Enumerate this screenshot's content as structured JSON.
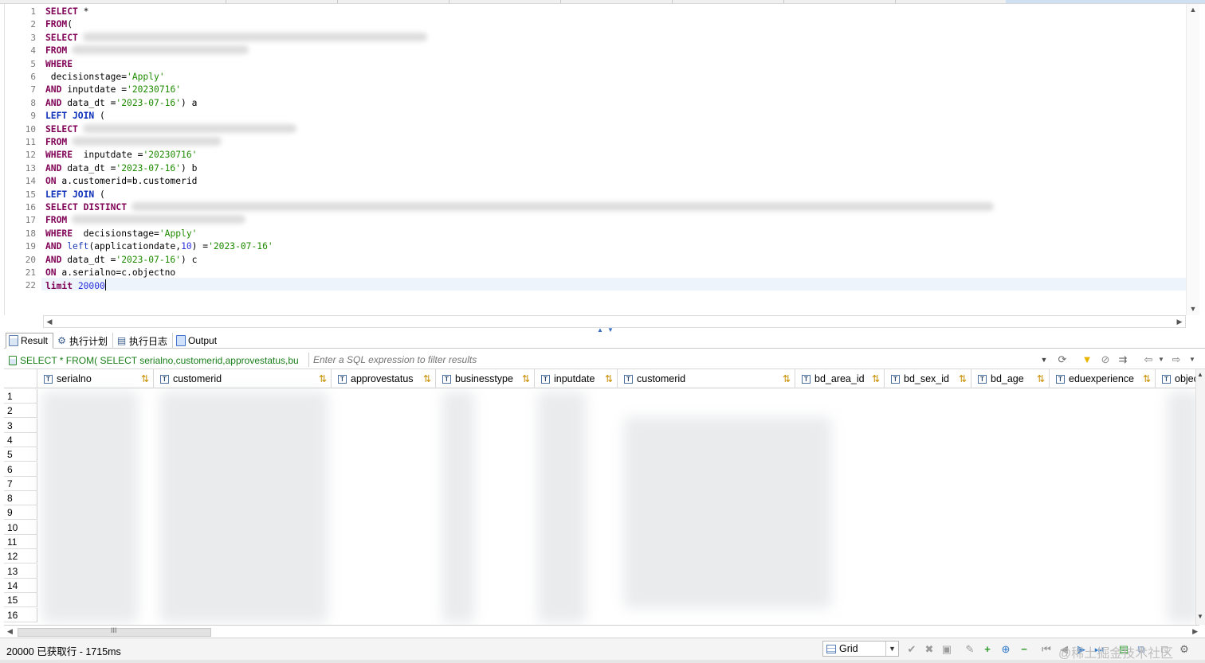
{
  "editor": {
    "lines": [
      {
        "n": "1",
        "tokens": [
          {
            "t": "SELECT",
            "c": "kw"
          },
          {
            "t": " *",
            "c": ""
          }
        ]
      },
      {
        "n": "2",
        "tokens": [
          {
            "t": "FROM",
            "c": "kw"
          },
          {
            "t": "(",
            "c": ""
          }
        ]
      },
      {
        "n": "3",
        "tokens": [
          {
            "t": "SELECT",
            "c": "kw"
          }
        ],
        "blur": 432
      },
      {
        "n": "4",
        "tokens": [
          {
            "t": "FROM",
            "c": "kw"
          }
        ],
        "blur": 222
      },
      {
        "n": "5",
        "tokens": [
          {
            "t": "WHERE",
            "c": "kw"
          }
        ]
      },
      {
        "n": "6",
        "tokens": [
          {
            "t": " decisionstage=",
            "c": ""
          },
          {
            "t": "'Apply'",
            "c": "str"
          }
        ]
      },
      {
        "n": "7",
        "tokens": [
          {
            "t": "AND",
            "c": "kw"
          },
          {
            "t": " inputdate =",
            "c": ""
          },
          {
            "t": "'20230716'",
            "c": "str"
          }
        ]
      },
      {
        "n": "8",
        "tokens": [
          {
            "t": "AND",
            "c": "kw"
          },
          {
            "t": " data_dt =",
            "c": ""
          },
          {
            "t": "'2023-07-16'",
            "c": "str"
          },
          {
            "t": ") a",
            "c": ""
          }
        ]
      },
      {
        "n": "9",
        "tokens": [
          {
            "t": "LEFT JOIN",
            "c": "kw2"
          },
          {
            "t": " (",
            "c": ""
          }
        ]
      },
      {
        "n": "10",
        "tokens": [
          {
            "t": "SELECT",
            "c": "kw"
          }
        ],
        "blur": 268
      },
      {
        "n": "11",
        "tokens": [
          {
            "t": "FROM",
            "c": "kw"
          }
        ],
        "blur": 188
      },
      {
        "n": "12",
        "tokens": [
          {
            "t": "WHERE",
            "c": "kw"
          },
          {
            "t": "  inputdate =",
            "c": ""
          },
          {
            "t": "'20230716'",
            "c": "str"
          }
        ]
      },
      {
        "n": "13",
        "tokens": [
          {
            "t": "AND",
            "c": "kw"
          },
          {
            "t": " data_dt =",
            "c": ""
          },
          {
            "t": "'2023-07-16'",
            "c": "str"
          },
          {
            "t": ") b",
            "c": ""
          }
        ]
      },
      {
        "n": "14",
        "tokens": [
          {
            "t": "ON",
            "c": "kw"
          },
          {
            "t": " a.customerid=b.customerid",
            "c": ""
          }
        ]
      },
      {
        "n": "15",
        "tokens": [
          {
            "t": "LEFT JOIN",
            "c": "kw2"
          },
          {
            "t": " (",
            "c": ""
          }
        ]
      },
      {
        "n": "16",
        "tokens": [
          {
            "t": "SELECT DISTINCT",
            "c": "kw"
          }
        ],
        "blur": 1082
      },
      {
        "n": "17",
        "tokens": [
          {
            "t": "FROM",
            "c": "kw"
          }
        ],
        "blur": 218
      },
      {
        "n": "18",
        "tokens": [
          {
            "t": "WHERE",
            "c": "kw"
          },
          {
            "t": "  decisionstage=",
            "c": ""
          },
          {
            "t": "'Apply'",
            "c": "str"
          }
        ]
      },
      {
        "n": "19",
        "tokens": [
          {
            "t": "AND",
            "c": "kw"
          },
          {
            "t": " ",
            "c": ""
          },
          {
            "t": "left",
            "c": "fn"
          },
          {
            "t": "(applicationdate,",
            "c": ""
          },
          {
            "t": "10",
            "c": "num"
          },
          {
            "t": ") =",
            "c": ""
          },
          {
            "t": "'2023-07-16'",
            "c": "str"
          }
        ]
      },
      {
        "n": "20",
        "tokens": [
          {
            "t": "AND",
            "c": "kw"
          },
          {
            "t": " data_dt =",
            "c": ""
          },
          {
            "t": "'2023-07-16'",
            "c": "str"
          },
          {
            "t": ") c",
            "c": ""
          }
        ]
      },
      {
        "n": "21",
        "tokens": [
          {
            "t": "ON",
            "c": "kw"
          },
          {
            "t": " a.serialno=c.objectno",
            "c": ""
          }
        ]
      },
      {
        "n": "22",
        "tokens": [
          {
            "t": "limit",
            "c": "kw"
          },
          {
            "t": " ",
            "c": ""
          },
          {
            "t": "20000",
            "c": "num"
          }
        ],
        "caret": true
      }
    ]
  },
  "result_tabs": [
    {
      "label": "Result",
      "icon": "result-doc-icon",
      "active": true
    },
    {
      "label": "执行计划",
      "icon": "execution-plan-icon",
      "active": false
    },
    {
      "label": "执行日志",
      "icon": "execution-log-icon",
      "active": false
    },
    {
      "label": "Output",
      "icon": "output-doc-icon",
      "active": false
    }
  ],
  "filter": {
    "query_text": "SELECT * FROM( SELECT serialno,customerid,approvestatus,bu",
    "placeholder": "Enter a SQL expression to filter results"
  },
  "grid": {
    "columns": [
      {
        "name": "serialno"
      },
      {
        "name": "customerid"
      },
      {
        "name": "approvestatus"
      },
      {
        "name": "businesstype"
      },
      {
        "name": "inputdate"
      },
      {
        "name": "customerid"
      },
      {
        "name": "bd_area_id"
      },
      {
        "name": "bd_sex_id"
      },
      {
        "name": "bd_age"
      },
      {
        "name": "eduexperience"
      },
      {
        "name": "object"
      }
    ],
    "row_numbers": [
      "1",
      "2",
      "3",
      "4",
      "5",
      "6",
      "7",
      "8",
      "9",
      "10",
      "11",
      "12",
      "13",
      "14",
      "15",
      "16"
    ]
  },
  "status": {
    "text": "20000 已获取行 - 1715ms",
    "view_mode": "Grid",
    "watermark": "@稀土掘金技术社区"
  },
  "colors": {
    "keyword": "#7f0055",
    "string": "#1e8a00",
    "number": "#2b30d8",
    "query_chip": "#1a7f1a",
    "filter_icon": "#e8b400"
  }
}
